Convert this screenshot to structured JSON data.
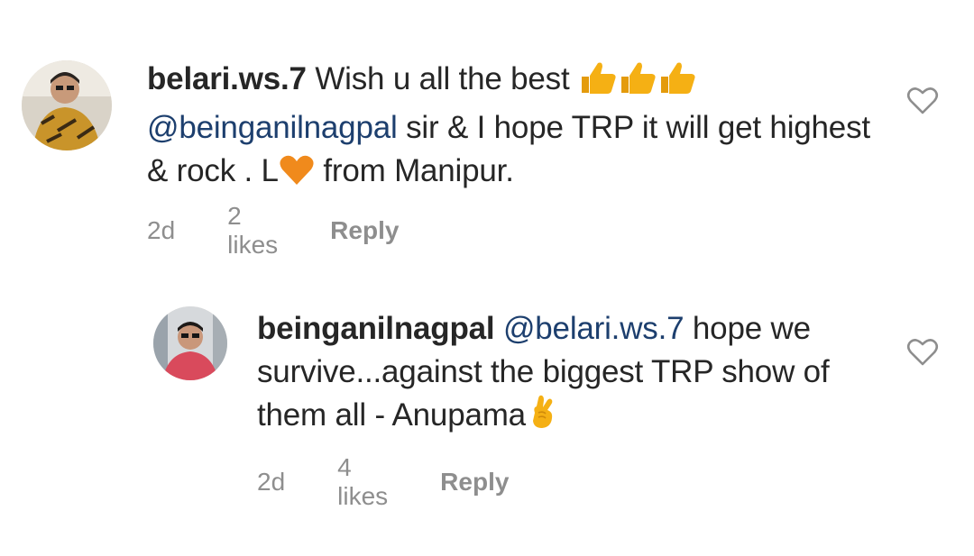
{
  "comments": [
    {
      "username": "belari.ws.7",
      "text_1": " Wish u all the best ",
      "mention": "@beinganilnagpal",
      "text_2": " sir & I hope TRP it will get highest & rock . L",
      "text_3": " from Manipur.",
      "emojis": [
        "thumbs-up",
        "thumbs-up",
        "thumbs-up",
        "orange-heart"
      ],
      "age": "2d",
      "likes": "2 likes",
      "reply_label": "Reply"
    },
    {
      "username": "beinganilnagpal",
      "mention": "@belari.ws.7",
      "text_1": " hope we survive...against the biggest TRP show of them all - Anupama",
      "emojis": [
        "crossed-fingers"
      ],
      "age": "2d",
      "likes": "4 likes",
      "reply_label": "Reply"
    }
  ],
  "colors": {
    "text": "#262626",
    "secondary": "#8e8e8e",
    "mention": "#1d3f6e",
    "emoji_yellow": "#f5b014",
    "heart_orange": "#f08a1c"
  }
}
